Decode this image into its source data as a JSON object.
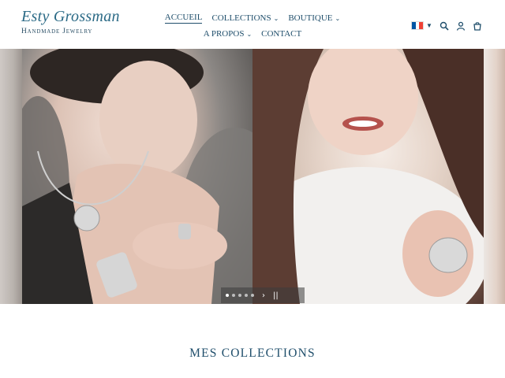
{
  "header": {
    "logo": {
      "script": "Esty Grossman",
      "subtitle": "Handmade Jewelry"
    },
    "nav": {
      "row1": [
        {
          "label": "ACCUEIL",
          "active": true,
          "dropdown": false
        },
        {
          "label": "COLLECTIONS",
          "active": false,
          "dropdown": true
        },
        {
          "label": "BOUTIQUE",
          "active": false,
          "dropdown": true
        }
      ],
      "row2": [
        {
          "label": "A PROPOS",
          "active": false,
          "dropdown": true
        },
        {
          "label": "CONTACT",
          "active": false,
          "dropdown": false
        }
      ]
    },
    "icons": {
      "language_flag": "flag-france-icon",
      "search": "search-icon",
      "account": "user-icon",
      "cart": "cart-icon"
    },
    "colors": {
      "brand": "#1f4e6b",
      "flag_blue": "#0055a4",
      "flag_white": "#ffffff",
      "flag_red": "#ef4135"
    }
  },
  "hero": {
    "slides_count": 5,
    "active_slide": 1,
    "controls": {
      "next": "›",
      "pause": "||"
    }
  },
  "section": {
    "title": "MES COLLECTIONS"
  }
}
